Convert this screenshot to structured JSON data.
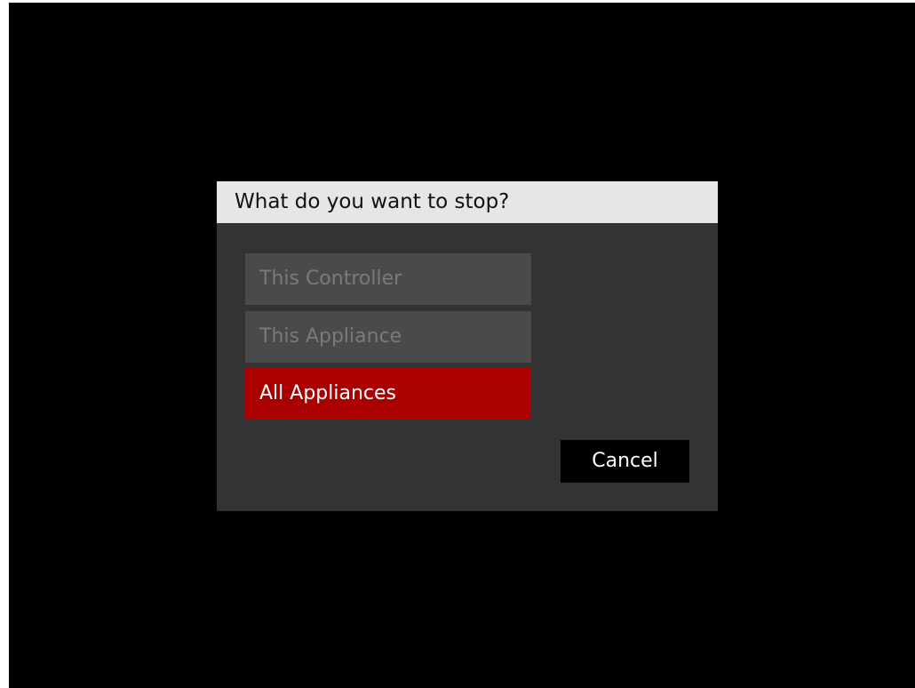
{
  "dialog": {
    "title": "What do you want to stop?",
    "options": [
      {
        "label": "This Controller",
        "state": "disabled"
      },
      {
        "label": "This Appliance",
        "state": "disabled"
      },
      {
        "label": "All Appliances",
        "state": "selected"
      }
    ],
    "cancel_label": "Cancel"
  },
  "colors": {
    "screen_background": "#000000",
    "dialog_background": "#333333",
    "header_background": "#e6e6e6",
    "option_disabled_background": "#4a4a4a",
    "option_disabled_text": "#7a7a7a",
    "option_selected_background": "#aa0000",
    "cancel_background": "#000000"
  }
}
